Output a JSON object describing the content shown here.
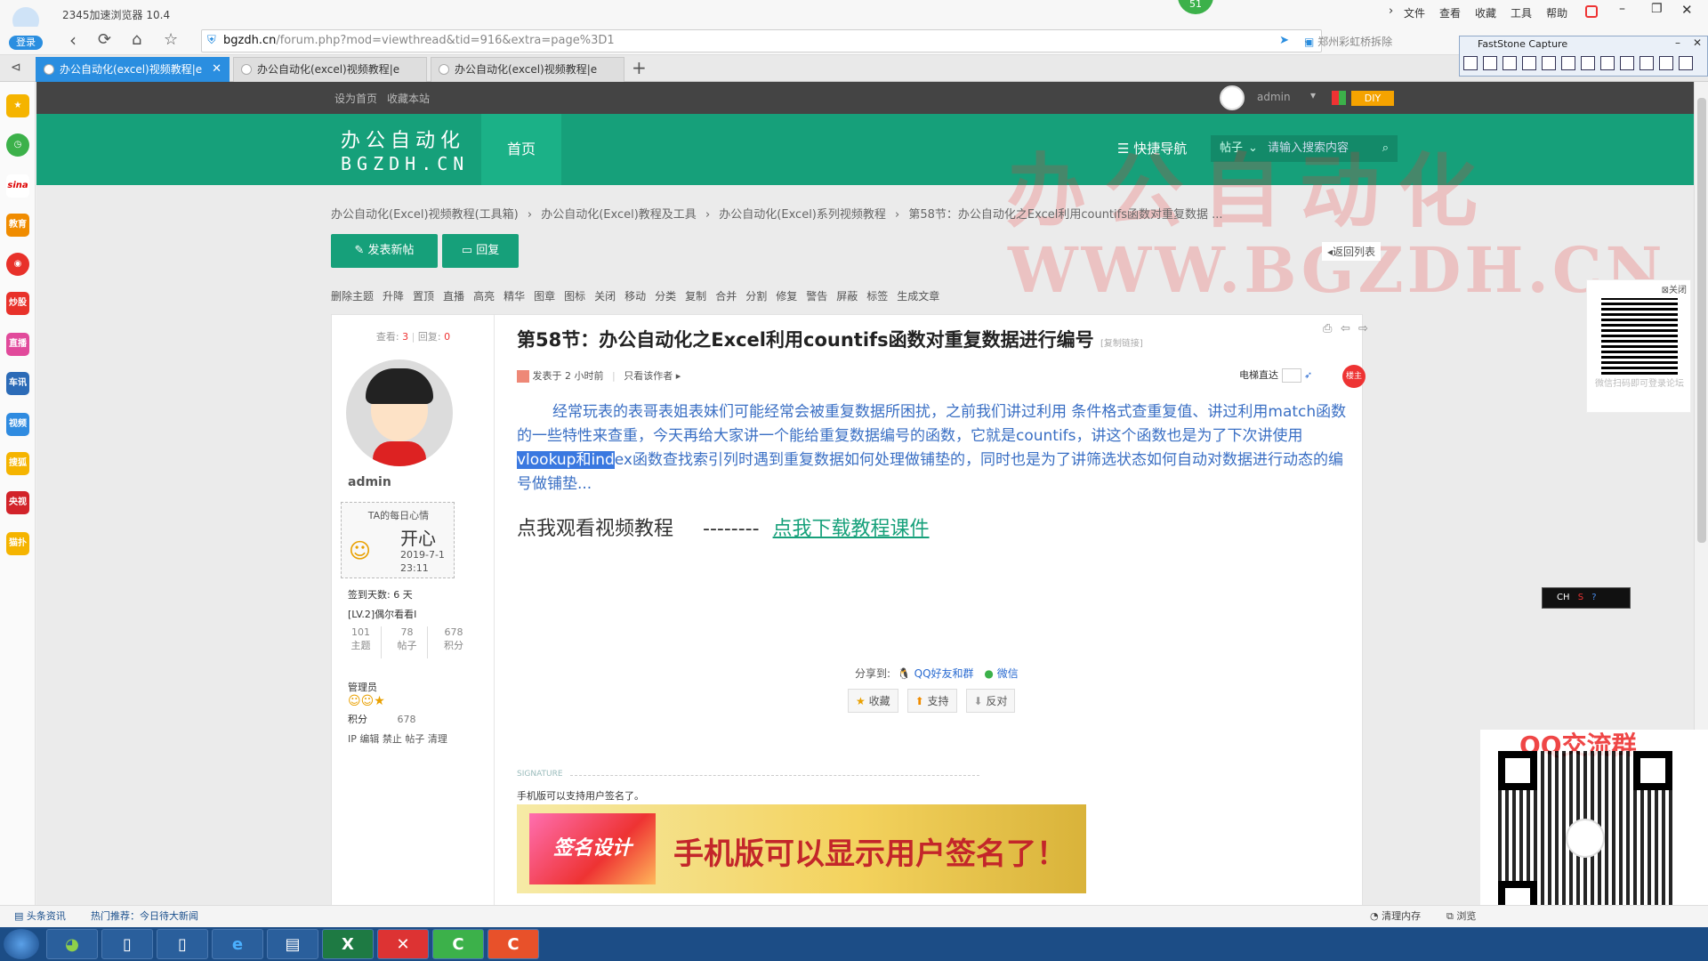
{
  "browser": {
    "app_title": "2345加速浏览器 10.4",
    "login_label": "登录",
    "url_domain": "bgzdh.cn",
    "url_path": "/forum.php?mod=viewthread&tid=916&extra=page%3D1",
    "ad_text": "郑州彩虹桥拆除",
    "menu": [
      "文件",
      "查看",
      "收藏",
      "工具",
      "帮助"
    ],
    "badge": "51",
    "tabs": [
      {
        "label": "办公自动化(excel)视频教程|e"
      },
      {
        "label": "办公自动化(excel)视频教程|e"
      },
      {
        "label": "办公自动化(excel)视频教程|e"
      }
    ],
    "new_tab": "+"
  },
  "faststone": {
    "title": "FastStone Capture"
  },
  "rail": {
    "items": [
      {
        "label": "",
        "color": "#f5b400"
      },
      {
        "label": "",
        "color": "#3cb14a"
      },
      {
        "label": "sina",
        "color": "#ffffff"
      },
      {
        "label": "教育",
        "color": "#f08c00"
      },
      {
        "label": "",
        "color": "#e8312a"
      },
      {
        "label": "炒股",
        "color": "#e8312a"
      },
      {
        "label": "直播",
        "color": "#e14a9b"
      },
      {
        "label": "车讯",
        "color": "#2c6bb7"
      },
      {
        "label": "视频",
        "color": "#2f8be0"
      },
      {
        "label": "搜狐",
        "color": "#f5b400"
      },
      {
        "label": "央视",
        "color": "#d2232a"
      },
      {
        "label": "猫扑",
        "color": "#f5b400"
      }
    ]
  },
  "site": {
    "top_links": [
      "设为首页",
      "收藏本站"
    ],
    "user": "admin",
    "diy": "DIY",
    "logo_cn": "办公自动化",
    "logo_en": "BGZDH.CN",
    "nav_home": "首页",
    "quick_nav": "快捷导航",
    "post_select": "帖子",
    "search_placeholder": "请输入搜索内容",
    "breadcrumb": [
      "办公自动化(Excel)视频教程(工具箱)",
      "办公自动化(Excel)教程及工具",
      "办公自动化(Excel)系列视频教程",
      "第58节：办公自动化之Excel利用countifs函数对重复数据 ..."
    ],
    "new_post_btn": "发表新帖",
    "reply_btn": "回复",
    "back_list": "返回列表",
    "admin_tools": [
      "删除主题",
      "升降",
      "置顶",
      "直播",
      "高亮",
      "精华",
      "图章",
      "图标",
      "关闭",
      "移动",
      "分类",
      "复制",
      "合并",
      "分割",
      "修复",
      "警告",
      "屏蔽",
      "标签",
      "生成文章"
    ],
    "watermark_cn": "办公自动化",
    "watermark_en": "WWW.BGZDH.CN"
  },
  "profile": {
    "views_label": "查看:",
    "views": "3",
    "replies_label": "回复:",
    "replies": "0",
    "name": "admin",
    "mood_title": "TA的每日心情",
    "mood": "开心",
    "mood_date": "2019-7-1",
    "mood_time": "23:11",
    "signin": "签到天数: 6 天",
    "level": "[LV.2]偶尔看看I",
    "stats": [
      {
        "value": "101",
        "label": "主题"
      },
      {
        "value": "78",
        "label": "帖子"
      },
      {
        "value": "678",
        "label": "积分"
      }
    ],
    "role": "管理员",
    "points_label": "积分",
    "points": "678",
    "tools": "IP 编辑 禁止 帖子 清理"
  },
  "post": {
    "title": "第58节：办公自动化之Excel利用countifs函数对重复数据进行编号",
    "copy_link": "[复制链接]",
    "meta_time": "发表于 2 小时前",
    "author_only": "只看该作者",
    "elevator": "电梯直达",
    "owner": "楼主",
    "para_before": "经常玩表的表哥表姐表妹们可能经常会被重复数据所困扰，之前我们讲过利用 条件格式查重复值、讲过利用match函数的一些特性来查重，今天再给大家讲一个能给重复数据编号的函数，它就是countifs，讲这个函数也是为了下次讲使用",
    "para_selected": "vlookup和ind",
    "para_after": "ex函数查找索引列时遇到重复数据如何处理做铺垫的，同时也是为了讲筛选状态如何自动对数据进行动态的编号做铺垫...",
    "watch_video": "点我观看视频教程",
    "dashes": "--------",
    "download": "点我下载教程课件",
    "share_label": "分享到:",
    "share_qq": "QQ好友和群",
    "share_wechat": "微信",
    "fav": "收藏",
    "support": "支持",
    "oppose": "反对",
    "signature_label": "SIGNATURE",
    "signature_text": "手机版可以支持用户签名了。",
    "banner_logo": "签名设计",
    "banner_text": "手机版可以显示用户签名了！"
  },
  "qr": {
    "close": "关闭",
    "caption": "微信扫码即可登录论坛",
    "group_label": "QQ交流群"
  },
  "ime": {
    "label": "CH"
  },
  "statusbar": {
    "news": "头条资讯",
    "hot": "热门推荐：今日待大新闻",
    "clean": "清理内存",
    "browse": "浏览"
  }
}
